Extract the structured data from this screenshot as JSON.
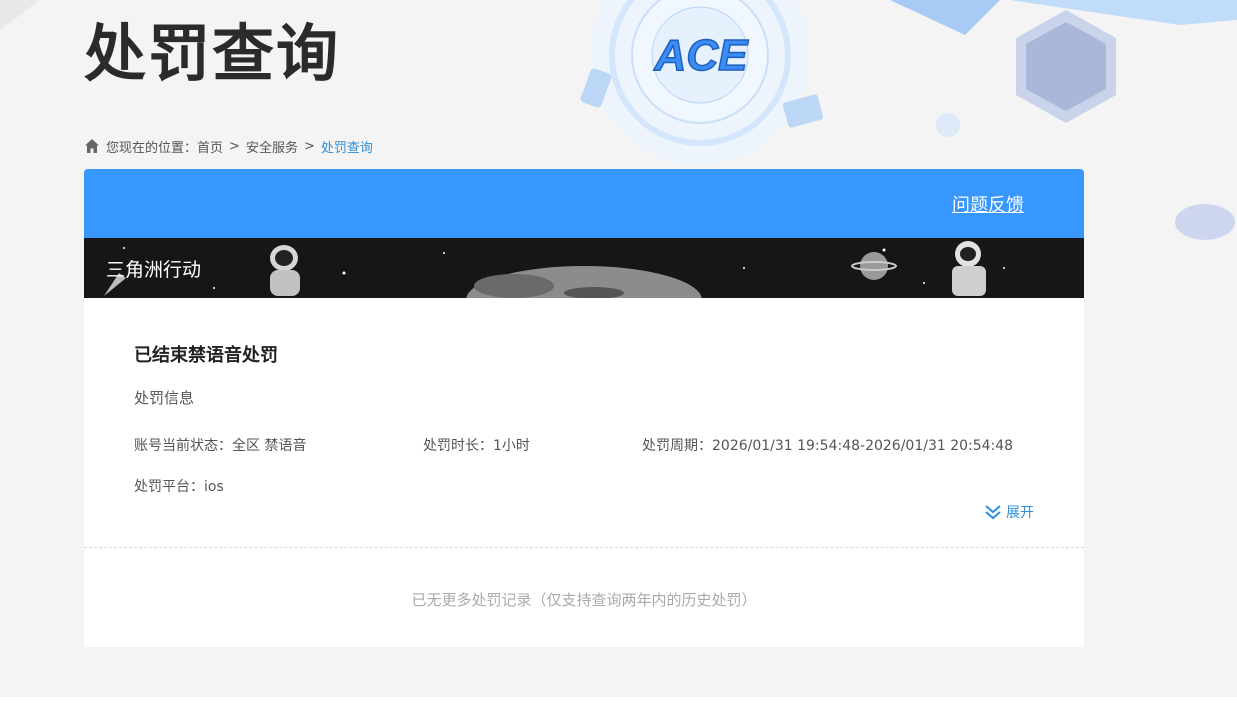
{
  "header": {
    "page_title": "处罚查询",
    "logo_text": "ACE"
  },
  "breadcrumb": {
    "prefix": "您现在的位置：",
    "items": [
      "首页",
      "安全服务",
      "处罚查询"
    ],
    "separator": ">"
  },
  "card": {
    "feedback_label": "问题反馈",
    "game_name": "三角洲行动",
    "record": {
      "title": "已结束禁语音处罚",
      "subtitle": "处罚信息",
      "status_label": "账号当前状态：全区 禁语音",
      "duration_label": "处罚时长：1小时",
      "period_label": "处罚周期：2026/01/31 19:54:48-2026/01/31 20:54:48",
      "platform_label": "处罚平台：ios",
      "expand_label": "展开"
    },
    "no_more_text": "已无更多处罚记录（仅支持查询两年内的历史处罚）"
  },
  "colors": {
    "accent_blue": "#3797fd",
    "link_blue": "#2f8fdb",
    "banner_dark": "#161616"
  }
}
